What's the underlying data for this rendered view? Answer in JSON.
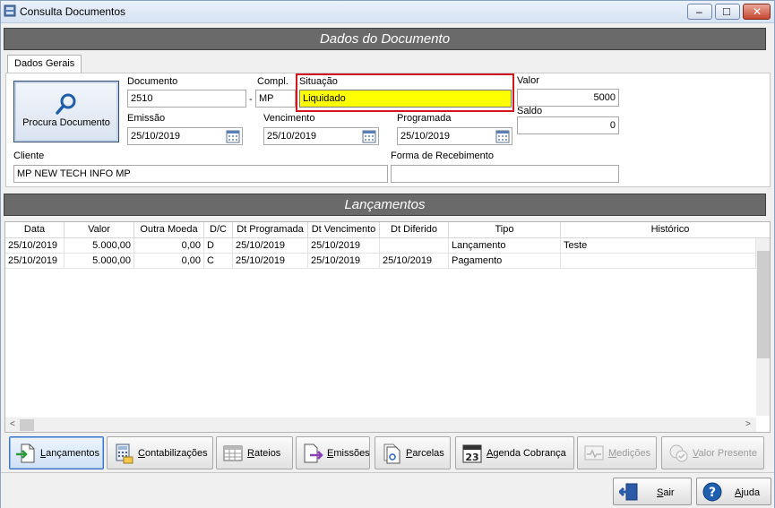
{
  "window": {
    "title": "Consulta Documentos",
    "min_label": "–",
    "max_label": "□",
    "close_label": "✕"
  },
  "sections": {
    "dados_title": "Dados do Documento",
    "lancamentos_title": "Lançamentos"
  },
  "tabs": {
    "dados_gerais": "Dados Gerais"
  },
  "search_button": {
    "label": "Procura Documento",
    "icon": "magnifier-icon"
  },
  "fields": {
    "documento": {
      "label": "Documento",
      "value": "2510"
    },
    "separator": "-",
    "compl": {
      "label": "Compl.",
      "value": "MP"
    },
    "situacao": {
      "label": "Situação",
      "value": "Liquidado",
      "color": "#ffff00",
      "highlight": "#d3151d"
    },
    "valor": {
      "label": "Valor",
      "value": "5000"
    },
    "saldo": {
      "label": "Saldo",
      "value": "0"
    },
    "emissao": {
      "label": "Emissão",
      "value": "25/10/2019"
    },
    "vencimento": {
      "label": "Vencimento",
      "value": "25/10/2019"
    },
    "programada": {
      "label": "Programada",
      "value": "25/10/2019"
    },
    "cliente": {
      "label": "Cliente",
      "value": "MP NEW TECH INFO MP"
    },
    "forma_recebimento": {
      "label": "Forma de Recebimento",
      "value": ""
    }
  },
  "grid": {
    "columns": [
      "Data",
      "Valor",
      "Outra Moeda",
      "D/C",
      "Dt Programada",
      "Dt Vencimento",
      "Dt Diferido",
      "Tipo",
      "Histórico"
    ],
    "rows": [
      [
        "25/10/2019",
        "5.000,00",
        "0,00",
        "D",
        "25/10/2019",
        "25/10/2019",
        "",
        "Lançamento",
        "Teste"
      ],
      [
        "25/10/2019",
        "5.000,00",
        "0,00",
        "C",
        "25/10/2019",
        "25/10/2019",
        "25/10/2019",
        "Pagamento",
        ""
      ]
    ],
    "scroll_left": "<",
    "scroll_right": ">"
  },
  "toolbar": {
    "lancamentos": {
      "u": "L",
      "rest": "ançamentos"
    },
    "contabilizacoes": {
      "u": "C",
      "rest": "ontabilizações"
    },
    "rateios": {
      "u": "R",
      "rest": "ateios"
    },
    "emissoes": {
      "u": "E",
      "rest": "missões"
    },
    "parcelas": {
      "u": "P",
      "rest": "arcelas"
    },
    "agenda": {
      "u": "A",
      "rest": "genda Cobrança",
      "icon_text": "23"
    },
    "medicoes": {
      "u": "M",
      "rest": "edições"
    },
    "valor_presente": {
      "u": "V",
      "rest": "alor Presente"
    }
  },
  "footer": {
    "sair": {
      "u": "S",
      "rest": "air"
    },
    "ajuda": {
      "u": "A",
      "rest": "juda"
    }
  }
}
